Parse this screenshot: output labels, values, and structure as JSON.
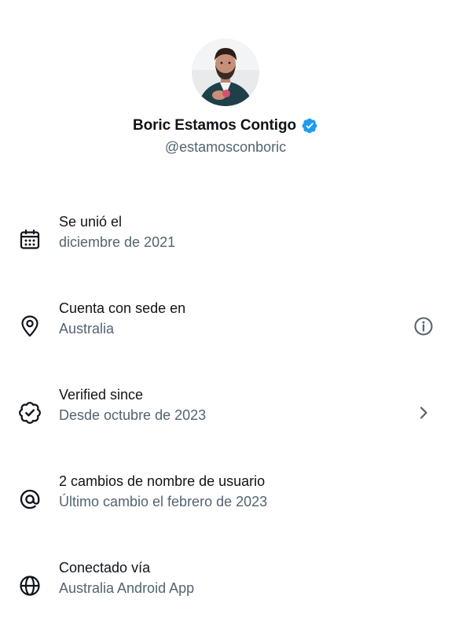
{
  "profile": {
    "display_name": "Boric Estamos Contigo",
    "handle": "@estamosconboric",
    "verified_color": "#1d9bf0"
  },
  "rows": [
    {
      "icon": "calendar-icon",
      "title": "Se unió el",
      "subtitle": "diciembre de 2021",
      "trailing": null
    },
    {
      "icon": "location-pin-icon",
      "title": "Cuenta con sede en",
      "subtitle": "Australia",
      "trailing": "info-icon"
    },
    {
      "icon": "verified-badge-outline-icon",
      "title": "Verified since",
      "subtitle": "Desde octubre de 2023",
      "trailing": "chevron-right-icon"
    },
    {
      "icon": "at-sign-icon",
      "title": "2 cambios de nombre de usuario",
      "subtitle": "Último cambio el febrero de 2023",
      "trailing": null
    },
    {
      "icon": "globe-icon",
      "title": "Conectado vía",
      "subtitle": "Australia Android App",
      "trailing": null
    }
  ],
  "colors": {
    "text_primary": "#0f1419",
    "text_secondary": "#536471",
    "accent": "#1d9bf0"
  }
}
